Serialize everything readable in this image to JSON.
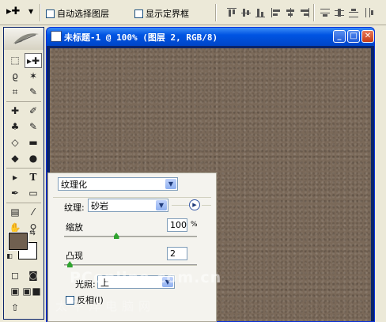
{
  "options_bar": {
    "auto_select_label": "自动选择图层",
    "show_bounds_label": "显示定界框"
  },
  "document": {
    "title": "未标题-1 @ 100% (图层 2, RGB/8)",
    "canvas_color": "#7a6959"
  },
  "toolbox": {
    "foreground_color": "#706050",
    "background_color": "#ffffff"
  },
  "texturizer": {
    "filter_name": "纹理化",
    "texture_label": "纹理:",
    "texture_value": "砂岩",
    "scaling_label": "缩放",
    "scaling_value": "100",
    "scaling_unit": "%",
    "scaling_level": 0.39,
    "relief_label": "凸现",
    "relief_value": "2",
    "relief_level": 0.04,
    "light_label": "光照:",
    "light_value": "上",
    "invert_label": "反相(I)",
    "invert_checked": false
  },
  "watermark": {
    "text": "PConline.com.cn",
    "text2": "太平洋电脑网"
  }
}
